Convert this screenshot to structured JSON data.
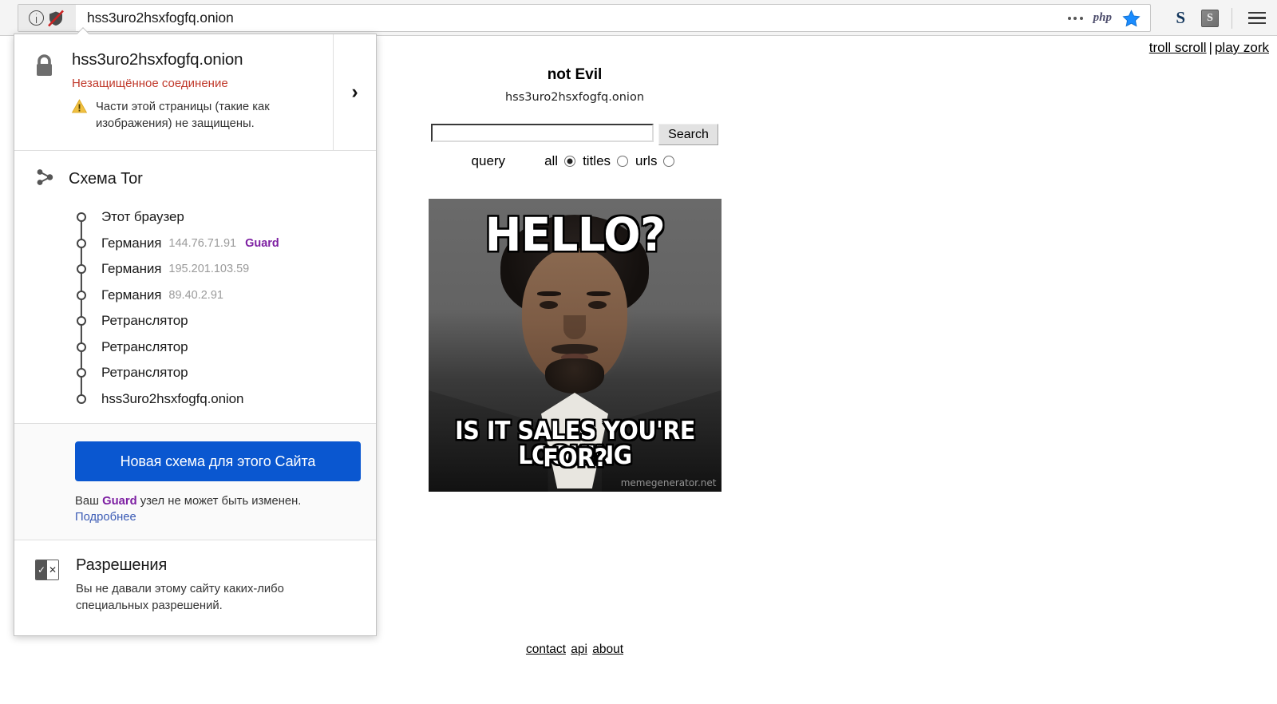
{
  "browser": {
    "url": "hss3uro2hsxfogfq.onion",
    "identity_icon": "info-circle-icon",
    "shield_icon": "shield-broken-icon",
    "urlbar_actions": [
      {
        "name": "page-actions-dots-icon",
        "label": ""
      },
      {
        "name": "php-extension-icon",
        "label": "php"
      },
      {
        "name": "bookmark-star-icon",
        "label": ""
      }
    ],
    "toolbar_right": [
      {
        "name": "extension-s-letter-icon",
        "label": "S"
      },
      {
        "name": "extension-s-box-icon",
        "label": "S"
      }
    ],
    "menu_icon": "hamburger-menu-icon"
  },
  "identity_popup": {
    "host": "hss3uro2hsxfogfq.onion",
    "connection_status": "Незащищённое соединение",
    "mixed_content_warning": "Части этой страницы (такие как изображения) не защищены.",
    "lock_icon": "lock-icon",
    "warning_icon": "warning-triangle-icon",
    "expand_chevron": "›",
    "tor": {
      "title": "Схема Tor",
      "icon": "tor-circuit-icon",
      "nodes": [
        {
          "label": "Этот браузер",
          "ip": "",
          "role": ""
        },
        {
          "label": "Германия",
          "ip": "144.76.71.91",
          "role": "Guard"
        },
        {
          "label": "Германия",
          "ip": "195.201.103.59",
          "role": ""
        },
        {
          "label": "Германия",
          "ip": "89.40.2.91",
          "role": ""
        },
        {
          "label": "Ретранслятор",
          "ip": "",
          "role": ""
        },
        {
          "label": "Ретранслятор",
          "ip": "",
          "role": ""
        },
        {
          "label": "Ретранслятор",
          "ip": "",
          "role": ""
        },
        {
          "label": "hss3uro2hsxfogfq.onion",
          "ip": "",
          "role": ""
        }
      ],
      "new_circuit_button": "Новая схема для этого Сайта",
      "guard_note_before": "Ваш ",
      "guard_note_bold": "Guard",
      "guard_note_after": " узел не может быть изменен.",
      "learn_more": "Подробнее"
    },
    "permissions": {
      "icon": "permissions-icon",
      "title": "Разрешения",
      "description": "Вы не давали этому сайту каких-либо специальных разрешений."
    }
  },
  "page": {
    "top_links": [
      {
        "label": "troll scroll"
      },
      {
        "label": "play zork"
      }
    ],
    "top_links_separator": "|",
    "site_title": "not Evil",
    "site_subtitle": "hss3uro2hsxfogfq.onion",
    "search": {
      "value": "",
      "placeholder": "",
      "button_label": "Search",
      "query_label": "query",
      "options": [
        {
          "label": "all",
          "selected": true
        },
        {
          "label": "titles",
          "selected": false
        },
        {
          "label": "urls",
          "selected": false
        }
      ]
    },
    "meme": {
      "top_text": "HELLO?",
      "bottom_text_line1": "IS IT SALES YOU'RE LOOKING",
      "bottom_text_line2": "FOR?",
      "watermark": "memegenerator.net"
    },
    "footer_links": [
      {
        "label": "contact"
      },
      {
        "label": "api"
      },
      {
        "label": "about"
      }
    ]
  },
  "colors": {
    "accent_blue": "#0a57d0",
    "guard_purple": "#7d1fa2",
    "insecure_red": "#c0392b",
    "link_blue": "#3b5bb5"
  }
}
